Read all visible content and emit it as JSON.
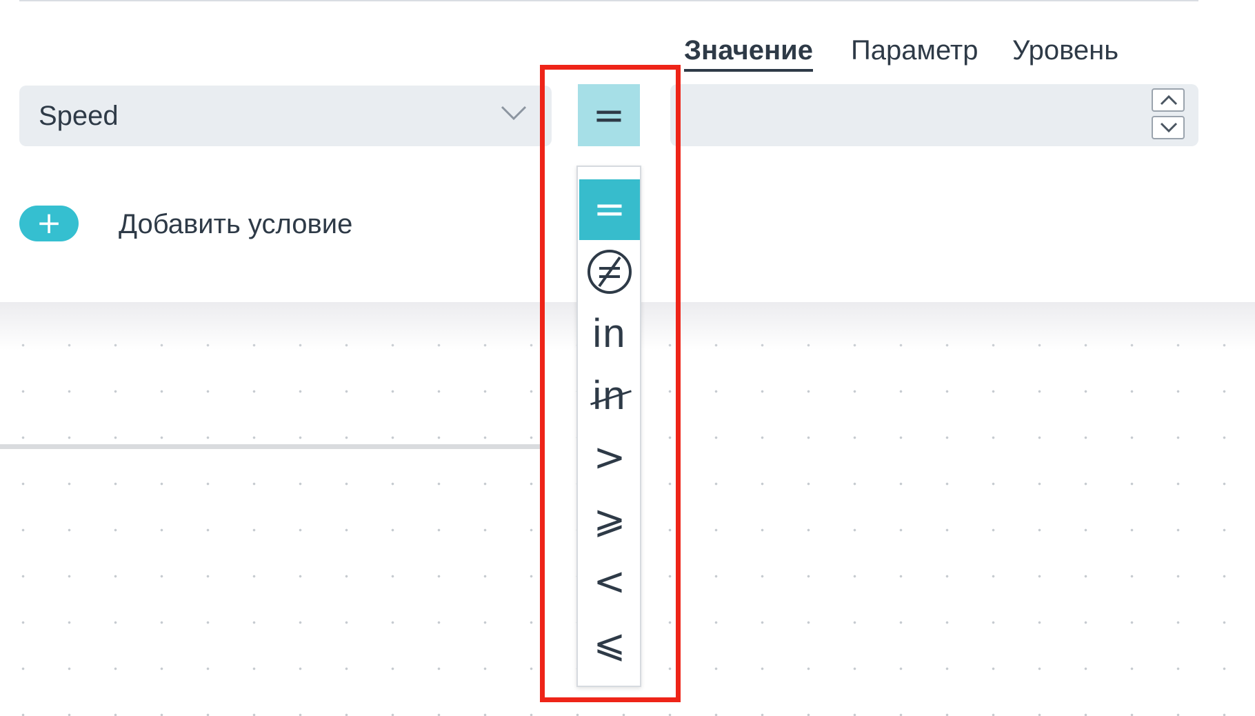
{
  "tabs": [
    {
      "label": "Значение",
      "active": true
    },
    {
      "label": "Параметр",
      "active": false
    },
    {
      "label": "Уровень",
      "active": false
    }
  ],
  "condition": {
    "field_value": "Speed",
    "operator_selected": "=",
    "value_input": ""
  },
  "operator_menu": {
    "options": [
      "=",
      "≠",
      "in",
      "in",
      ">",
      "⩾",
      "<",
      "⩽"
    ],
    "selected_index": 0
  },
  "add_condition": {
    "button_icon": "+",
    "label": "Добавить условие"
  },
  "colors": {
    "accent": "#35bfd0",
    "operator_bg": "#a6dfe7",
    "field_bg": "#e9edf1",
    "text": "#2e3a47",
    "highlight": "#ee2418"
  },
  "icons": [
    "chevron-down-icon",
    "chevron-up-icon",
    "plus-icon",
    "not-equal-icon"
  ]
}
